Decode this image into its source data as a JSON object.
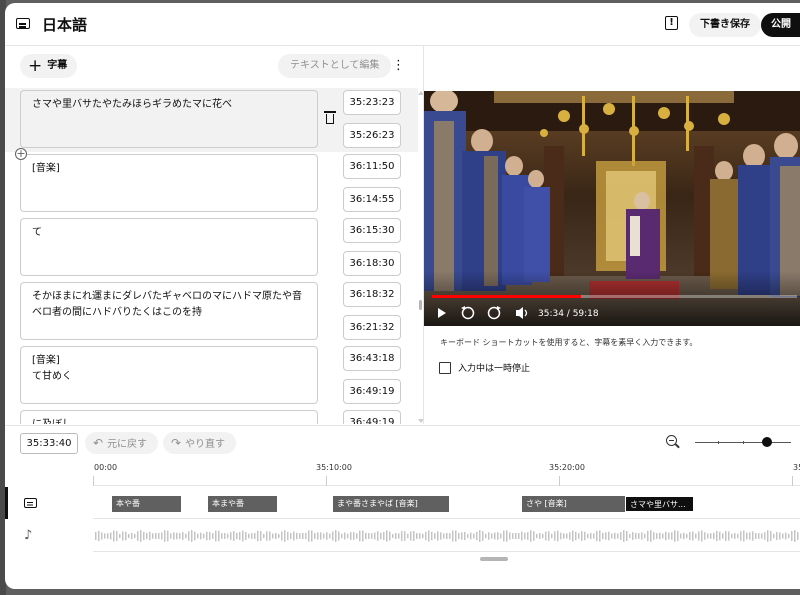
{
  "header": {
    "title": "日本語",
    "save_draft": "下書き保存",
    "publish": "公開"
  },
  "toolbar_top": {
    "add_caption": "字幕",
    "edit_as_text": "テキストとして編集"
  },
  "captions": [
    {
      "text": "さマや里バサたやたみほらギラめたマに花べ",
      "start": "35:23:23",
      "end": "35:26:23",
      "selected": true
    },
    {
      "text": "[音楽]",
      "start": "36:11:50",
      "end": "36:14:55"
    },
    {
      "text": "て",
      "start": "36:15:30",
      "end": "36:18:30"
    },
    {
      "text": "そかほまにれ運まにダレバたギャベロのマにハドマ原たや音ベロ者の間にハドバりたくはこのを持",
      "start": "36:18:32",
      "end": "36:21:32"
    },
    {
      "text": "[音楽]\nて甘めく",
      "start": "36:43:18",
      "end": "36:49:19"
    },
    {
      "text": "に及ぼし",
      "start": "36:49:19",
      "end": ""
    }
  ],
  "player": {
    "time_display": "35:34 / 59:18",
    "progress": 0.6
  },
  "shortcut_hint": "キーボード ショートカットを使用すると、字幕を素早く入力できます。",
  "pause_while_typing": "入力中は一時停止",
  "edit_toolbar": {
    "timecode": "35:33:40",
    "undo": "元に戻す",
    "redo": "やり直す"
  },
  "timeline": {
    "ruler_labels": [
      "00:00",
      "35:10:00",
      "35:20:00",
      "35"
    ],
    "segments": [
      {
        "text": "本や番",
        "active": false
      },
      {
        "text": "本まや番",
        "active": false
      },
      {
        "text": "まや番さまやば [音楽]",
        "active": false
      },
      {
        "text": "さや [音楽]",
        "active": false
      },
      {
        "text": "さマや里バサ...",
        "active": true
      }
    ]
  },
  "colors": {
    "accent_red": "#ff0000",
    "primary_dark": "#0f0f0f",
    "chip_bg": "#f2f2f2"
  }
}
